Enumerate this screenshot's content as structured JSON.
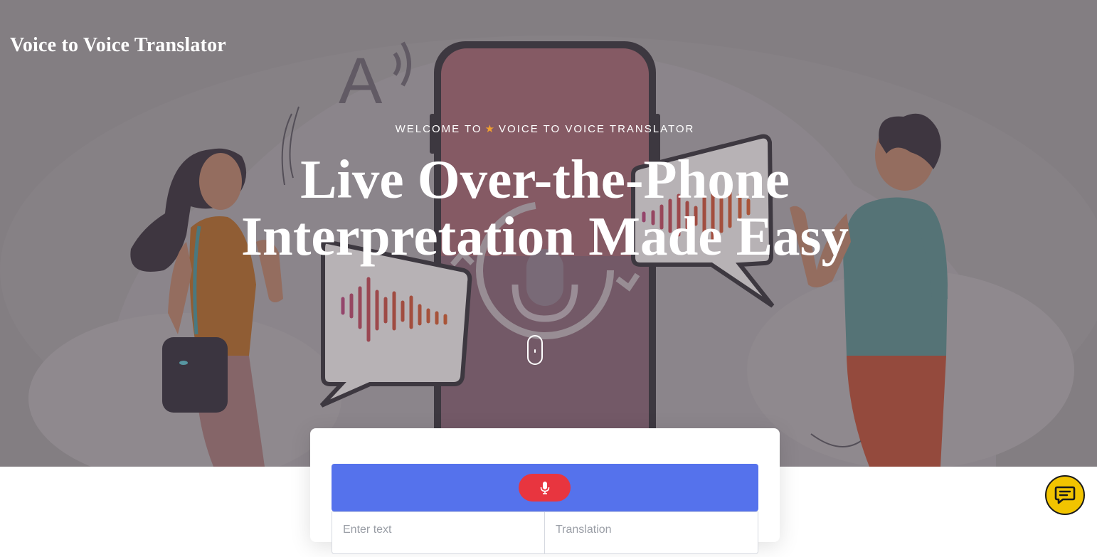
{
  "brand": {
    "title": "Voice to Voice Translator"
  },
  "hero": {
    "eyebrow_left": "WELCOME TO",
    "eyebrow_right": "VOICE TO VOICE TRANSLATOR",
    "headline_line1": "Live Over-the-Phone",
    "headline_line2": "Interpretation Made Easy",
    "illustration_glyph": "A"
  },
  "translator": {
    "mic_icon": "microphone-icon",
    "input_placeholder": "Enter text",
    "output_placeholder": "Translation"
  },
  "chat": {
    "icon": "chat-icon"
  },
  "colors": {
    "hero_bg": "#8a8689",
    "mic_bar": "#5572ec",
    "mic_button": "#e8353f",
    "chat_button": "#f2c400",
    "star": "#f0a030"
  }
}
